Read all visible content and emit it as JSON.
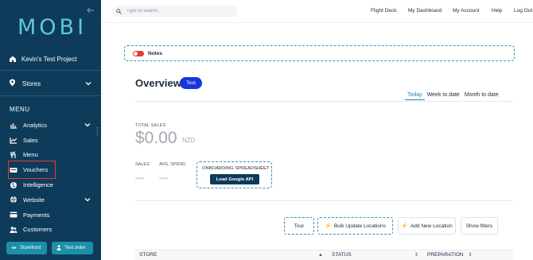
{
  "sidebar": {
    "logo": "MOBI",
    "project": "Kevin's Test Project",
    "stores_label": "Stores",
    "menu_title": "MENU",
    "items": [
      {
        "label": "Analytics",
        "icon": "bar-chart-icon",
        "has_chevron": true
      },
      {
        "label": "Sales",
        "icon": "line-chart-icon",
        "has_chevron": false
      },
      {
        "label": "Menu",
        "icon": "utensils-icon",
        "has_chevron": false
      },
      {
        "label": "Vouchers",
        "icon": "ticket-icon",
        "has_chevron": false,
        "active": true
      },
      {
        "label": "Intelligence",
        "icon": "brain-icon",
        "has_chevron": false
      },
      {
        "label": "Website",
        "icon": "globe-icon",
        "has_chevron": true
      },
      {
        "label": "Payments",
        "icon": "card-icon",
        "has_chevron": false
      },
      {
        "label": "Customers",
        "icon": "users-icon",
        "has_chevron": false
      }
    ],
    "storefront_label": "Storefront",
    "testorder_label": "Test order"
  },
  "topbar": {
    "search_placeholder": "Type to search...",
    "links": [
      "Flight Deck",
      "My Dashboard",
      "My Account",
      "Help",
      "Log Out"
    ]
  },
  "notes": {
    "label": "Notes",
    "toggle_on": false
  },
  "overview": {
    "title": "Overview",
    "badge": "Test",
    "tabs": [
      "Today",
      "Week to date",
      "Month to date"
    ],
    "active_tab": "Today",
    "total_sales_label": "TOTAL SALES",
    "total_sales_value": "$0.00",
    "currency": "NZD",
    "sales_label": "SALES",
    "sales_value": "—",
    "avg_spend_label": "AVG. SPEND",
    "avg_spend_value": "—",
    "onboarding_title": "ONBOARDING SPREADSHEET",
    "load_google_api": "Load Google API"
  },
  "actions": {
    "tour": "Tour",
    "bulk_update": "Bulk Update Locations",
    "add_location": "Add New Location",
    "show_filters": "Show filters"
  },
  "table": {
    "headers": [
      "STORE",
      "STATUS",
      "PREPARATION"
    ]
  },
  "colors": {
    "sidebar_bg": "#0e3b5a",
    "accent": "#1735d9",
    "brand": "#5fc7d6",
    "danger": "#e23b3b",
    "highlight_border": "#3a8fb7"
  }
}
